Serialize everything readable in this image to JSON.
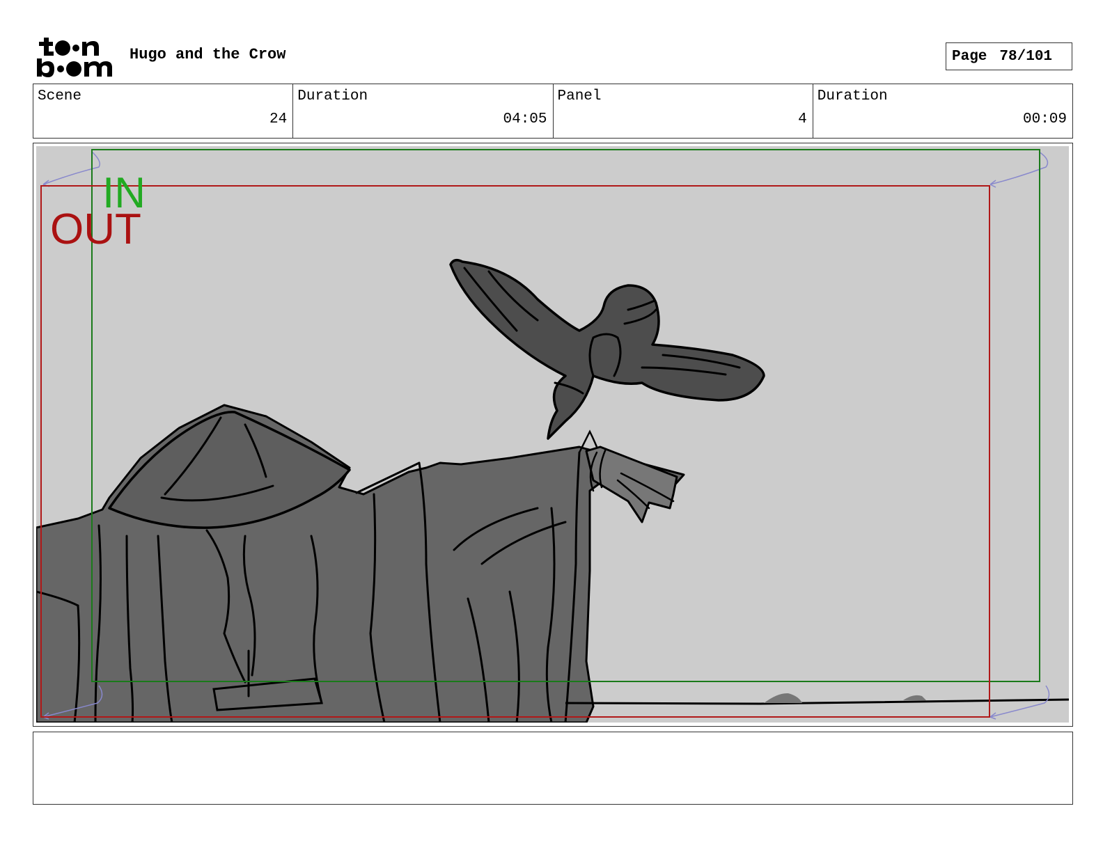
{
  "header": {
    "logo": {
      "line1": "toon",
      "line2": "boom"
    },
    "project_title": "Hugo and the Crow",
    "page": {
      "label": "Page",
      "value": "78/101"
    }
  },
  "info": [
    {
      "label": "Scene",
      "value": "24"
    },
    {
      "label": "Duration",
      "value": "04:05"
    },
    {
      "label": "Panel",
      "value": "4"
    },
    {
      "label": "Duration",
      "value": "00:09"
    }
  ],
  "panel": {
    "in_label": "IN",
    "out_label": "OUT",
    "colors": {
      "background": "#cccccc",
      "figure_fill": "#666666",
      "crow_fill": "#4d4d4d",
      "in_frame": "#1a7a1a",
      "in_text": "#22aa22",
      "out_frame": "#b01818",
      "out_text": "#aa1111",
      "camera_move": "#8888cc"
    }
  },
  "notes": {
    "text": ""
  }
}
